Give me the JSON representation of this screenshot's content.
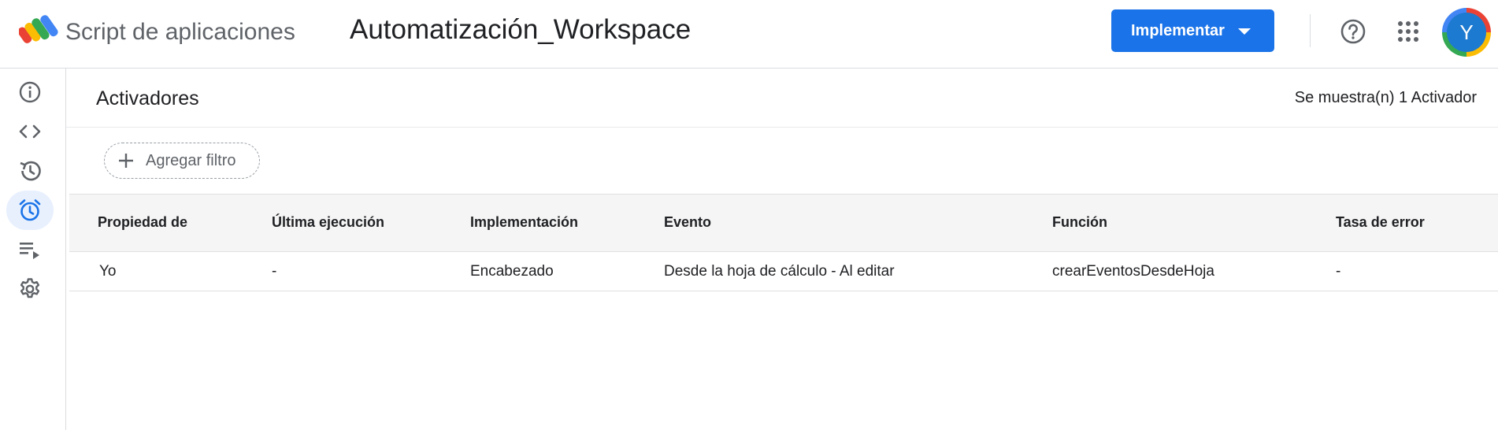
{
  "header": {
    "app_name": "Script de aplicaciones",
    "project_title": "Automatización_Workspace",
    "deploy_label": "Implementar",
    "avatar_initial": "Y"
  },
  "sidebar": {
    "items": [
      {
        "icon": "info-icon"
      },
      {
        "icon": "code-icon"
      },
      {
        "icon": "history-icon"
      },
      {
        "icon": "alarm-icon",
        "active": true
      },
      {
        "icon": "playlist-icon"
      },
      {
        "icon": "gear-icon"
      }
    ]
  },
  "main": {
    "title": "Activadores",
    "count_text": "Se muestra(n) 1 Activador",
    "filter_label": "Agregar filtro"
  },
  "table": {
    "columns": [
      "Propiedad de",
      "Última ejecución",
      "Implementación",
      "Evento",
      "Función",
      "Tasa de error"
    ],
    "rows": [
      [
        "Yo",
        "-",
        "Encabezado",
        "Desde la hoja de cálculo - Al editar",
        "crearEventosDesdeHoja",
        "-"
      ]
    ]
  },
  "colors": {
    "accent": "#1a73e8",
    "active_bg": "#e8f0fe",
    "header_bg": "#f5f5f5"
  }
}
